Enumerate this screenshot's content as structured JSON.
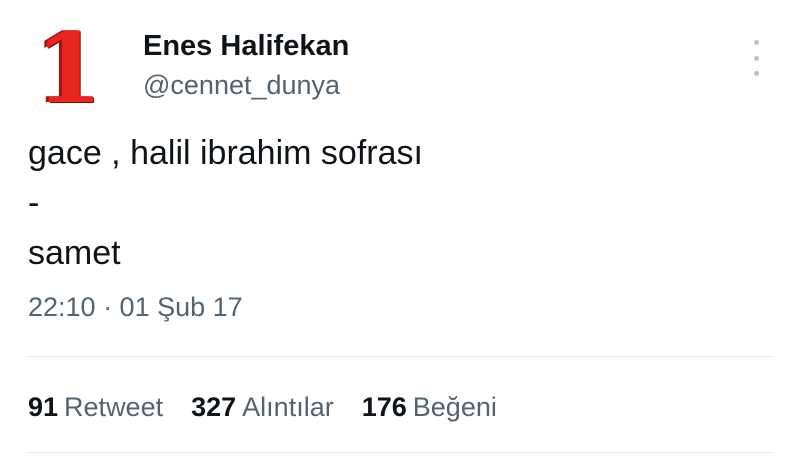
{
  "tweet": {
    "author": {
      "avatar_text": "1",
      "display_name": "Enes Halifekan",
      "handle": "@cennet_dunya"
    },
    "more_icon": "more-vertical-icon",
    "lines": [
      "gace , halil ibrahim sofrası",
      "-",
      "samet"
    ],
    "timestamp": "22:10 · 01 Şub 17",
    "stats": [
      {
        "count": "91",
        "label": "Retweet"
      },
      {
        "count": "327",
        "label": "Alıntılar"
      },
      {
        "count": "176",
        "label": "Beğeni"
      }
    ]
  },
  "colors": {
    "text": "#0f1419",
    "muted": "#536471",
    "avatar_red": "#e8261f",
    "divider": "#e1e8ed"
  }
}
